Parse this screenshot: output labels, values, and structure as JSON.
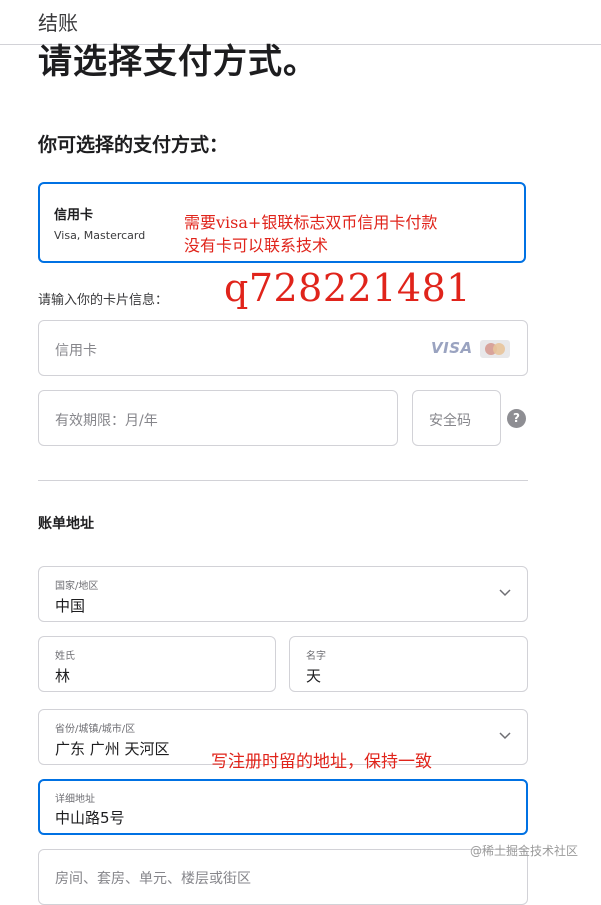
{
  "header": {
    "title": "结账"
  },
  "page": {
    "headline": "请选择支付方式。"
  },
  "payment": {
    "section_title": "你可选择的支付方式：",
    "option_name": "信用卡",
    "option_brands": "Visa, Mastercard",
    "card_prompt": "请输入你的卡片信息：",
    "card_placeholder": "信用卡",
    "visa_text": "VISA",
    "expiry_placeholder": "有效期限：月/年",
    "cvv_placeholder": "安全码",
    "help_symbol": "?"
  },
  "annotations": {
    "note_line1": "需要visa+银联标志双币信用卡付款",
    "note_line2": "没有卡可以联系技术",
    "contact": "q728221481",
    "address_note": "写注册时留的地址，保持一致"
  },
  "billing": {
    "title": "账单地址",
    "country_label": "国家/地区",
    "country_value": "中国",
    "last_name_label": "姓氏",
    "last_name_value": "林",
    "first_name_label": "名字",
    "first_name_value": "天",
    "region_label": "省份/城镇/城市/区",
    "region_value": "广东 广州 天河区",
    "street_label": "详细地址",
    "street_value": "中山路5号",
    "apt_placeholder": "房间、套房、单元、楼层或街区"
  },
  "watermark": "@稀土掘金技术社区",
  "colors": {
    "accent": "#0071e3",
    "annotation": "#e0241b",
    "border": "#d2d2d7"
  },
  "icons": [
    "visa-logo-icon",
    "mastercard-logo-icon",
    "help-icon",
    "chevron-down-icon"
  ]
}
